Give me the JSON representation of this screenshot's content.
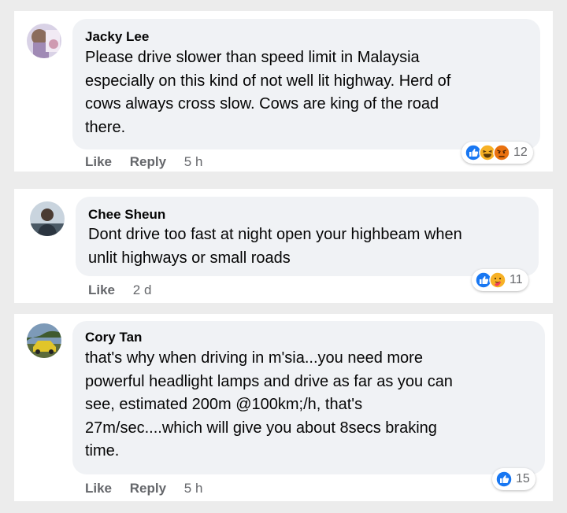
{
  "comments": [
    {
      "author": "Jacky Lee",
      "text": "Please drive slower than speed limit in Malaysia\nespecially on this kind of not well lit highway. Herd of\ncows always cross slow. Cows are king of the road\nthere.",
      "actions": [
        "Like",
        "Reply"
      ],
      "time": "5 h",
      "reactions": [
        "like-icon",
        "haha-icon",
        "angry-icon"
      ],
      "reaction_count": "12"
    },
    {
      "author": "Chee Sheun",
      "text": "Dont drive too fast at night open your highbeam when\nunlit highways or small roads",
      "actions": [
        "Like"
      ],
      "time": "2 d",
      "reactions": [
        "like-icon",
        "care-icon"
      ],
      "reaction_count": "11"
    },
    {
      "author": "Cory Tan",
      "text": "that's why when driving in m'sia...you need more\npowerful headlight lamps and drive as far as you can\nsee, estimated 200m @100km;/h, that's\n27m/sec....which will give you about 8secs braking\ntime.",
      "actions": [
        "Like",
        "Reply"
      ],
      "time": "5 h",
      "reactions": [
        "like-icon"
      ],
      "reaction_count": "15"
    }
  ],
  "colors": {
    "like_blue": "#1877f2",
    "haha_yellow": "#f7b125",
    "angry_red": "#e9710f",
    "bubble_bg": "#f0f2f5",
    "meta_gray": "#65676b"
  }
}
